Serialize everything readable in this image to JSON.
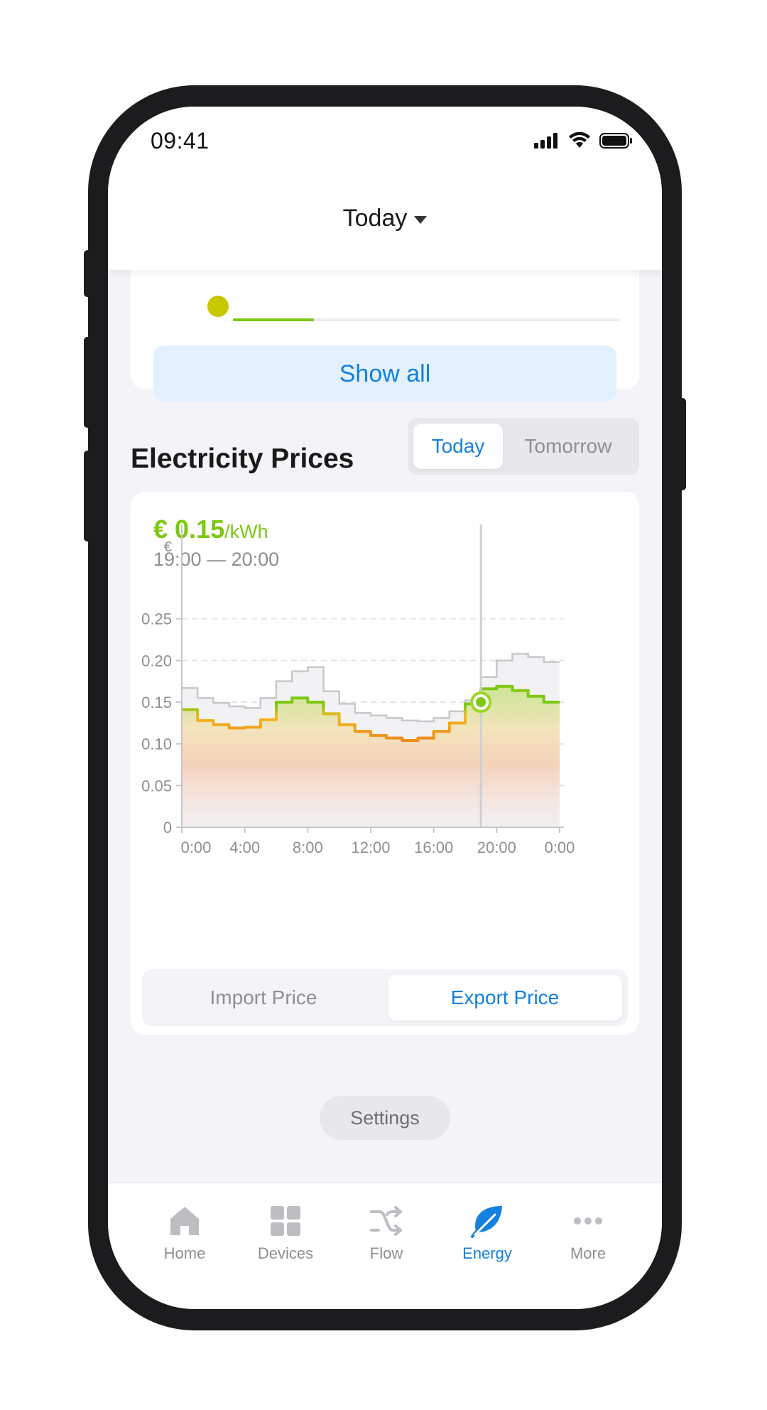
{
  "status": {
    "time": "09:41"
  },
  "header": {
    "title": "Today"
  },
  "top_card": {
    "progress": 0.21,
    "show_all_label": "Show all"
  },
  "prices_section": {
    "title": "Electricity Prices",
    "day_tabs": [
      {
        "label": "Today",
        "active": true
      },
      {
        "label": "Tomorrow",
        "active": false
      }
    ]
  },
  "price_card": {
    "price_value": "€ 0.15",
    "price_unit": "/kWh",
    "time_range": "19:00 — 20:00",
    "price_tabs": [
      {
        "label": "Import Price",
        "active": false
      },
      {
        "label": "Export Price",
        "active": true
      }
    ]
  },
  "chart_data": {
    "type": "line",
    "step": true,
    "x_ticks": [
      "0:00",
      "4:00",
      "8:00",
      "12:00",
      "16:00",
      "20:00",
      "0:00"
    ],
    "y_ticks": [
      "0",
      "0.05",
      "0.10",
      "0.15",
      "0.20",
      "0.25"
    ],
    "y_unit_label": "€",
    "ylim": [
      0,
      0.3
    ],
    "xlim": [
      0,
      24
    ],
    "series": [
      {
        "role": "import",
        "color": "#c7c7cc",
        "x": [
          0,
          1,
          2,
          3,
          4,
          5,
          6,
          7,
          8,
          9,
          10,
          11,
          12,
          13,
          14,
          15,
          16,
          17,
          18,
          19,
          20,
          21,
          22,
          23
        ],
        "values": [
          0.167,
          0.155,
          0.149,
          0.145,
          0.143,
          0.155,
          0.175,
          0.187,
          0.192,
          0.163,
          0.148,
          0.137,
          0.134,
          0.131,
          0.128,
          0.127,
          0.131,
          0.139,
          0.152,
          0.18,
          0.2,
          0.208,
          0.204,
          0.198
        ]
      },
      {
        "role": "export",
        "x": [
          0,
          1,
          2,
          3,
          4,
          5,
          6,
          7,
          8,
          9,
          10,
          11,
          12,
          13,
          14,
          15,
          16,
          17,
          18,
          19,
          20,
          21,
          22,
          23
        ],
        "values": [
          0.141,
          0.128,
          0.123,
          0.119,
          0.12,
          0.129,
          0.15,
          0.155,
          0.15,
          0.136,
          0.123,
          0.115,
          0.11,
          0.107,
          0.104,
          0.107,
          0.115,
          0.125,
          0.148,
          0.166,
          0.169,
          0.164,
          0.157,
          0.15
        ]
      }
    ],
    "selected_x": 19,
    "selected_value": 0.15,
    "grid": "dashed-horizontal"
  },
  "settings_label": "Settings",
  "tabbar": [
    {
      "label": "Home",
      "icon": "home-icon",
      "active": false
    },
    {
      "label": "Devices",
      "icon": "devices-icon",
      "active": false
    },
    {
      "label": "Flow",
      "icon": "flow-icon",
      "active": false
    },
    {
      "label": "Energy",
      "icon": "leaf-icon",
      "active": true
    },
    {
      "label": "More",
      "icon": "more-icon",
      "active": false
    }
  ],
  "colors": {
    "accent": "#1480e0",
    "price_green": "#7dc812",
    "price_orange": "#f08a1c"
  }
}
